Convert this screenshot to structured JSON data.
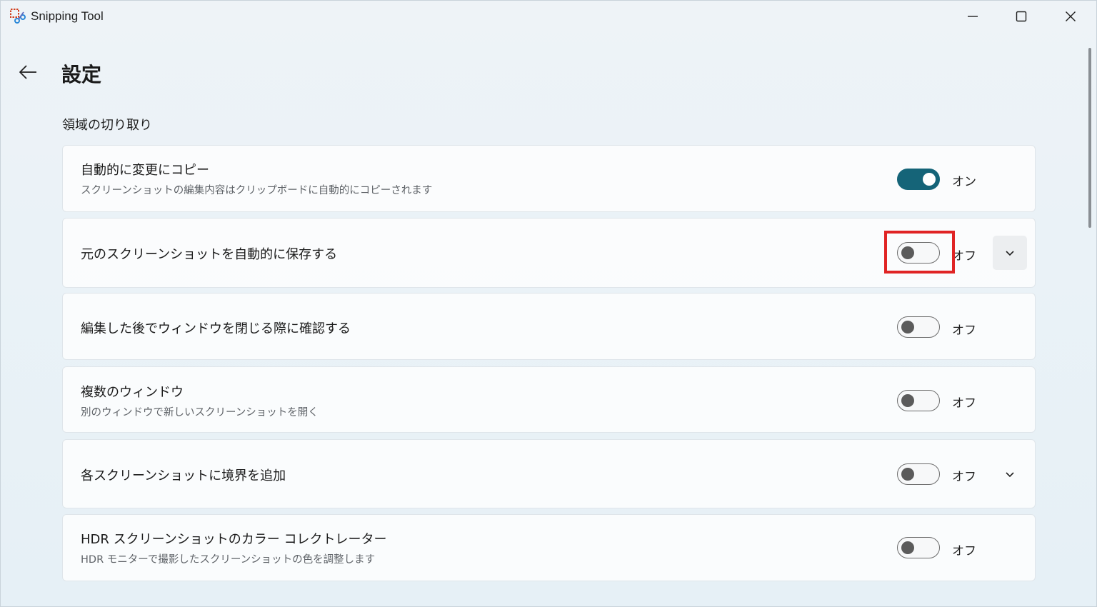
{
  "window": {
    "app_title": "Snipping Tool",
    "app_icon": "snipping-tool-icon",
    "buttons": [
      "minimize-icon",
      "maximize-icon",
      "close-icon"
    ]
  },
  "header": {
    "back_icon": "back-arrow-icon",
    "title": "設定"
  },
  "section": {
    "title": "領域の切り取り"
  },
  "settings": [
    {
      "title": "自動的に変更にコピー",
      "description": "スクリーンショットの編集内容はクリップボードに自動的にコピーされます",
      "toggle_on": true,
      "state_label": "オン",
      "expand": false
    },
    {
      "title": "元のスクリーンショットを自動的に保存する",
      "description": "",
      "toggle_on": false,
      "state_label": "オフ",
      "expand": true
    },
    {
      "title": "編集した後でウィンドウを閉じる際に確認する",
      "description": "",
      "toggle_on": false,
      "state_label": "オフ",
      "expand": false
    },
    {
      "title": "複数のウィンドウ",
      "description": "別のウィンドウで新しいスクリーンショットを開く",
      "toggle_on": false,
      "state_label": "オフ",
      "expand": false
    },
    {
      "title": "各スクリーンショットに境界を追加",
      "description": "",
      "toggle_on": false,
      "state_label": "オフ",
      "expand": true
    },
    {
      "title": "HDR スクリーンショットのカラー コレクトレーター",
      "description": "HDR モニターで撮影したスクリーンショットの色を調整します",
      "toggle_on": false,
      "state_label": "オフ",
      "expand": false
    }
  ],
  "colors": {
    "accent": "#156478",
    "highlight": "#e02424"
  }
}
